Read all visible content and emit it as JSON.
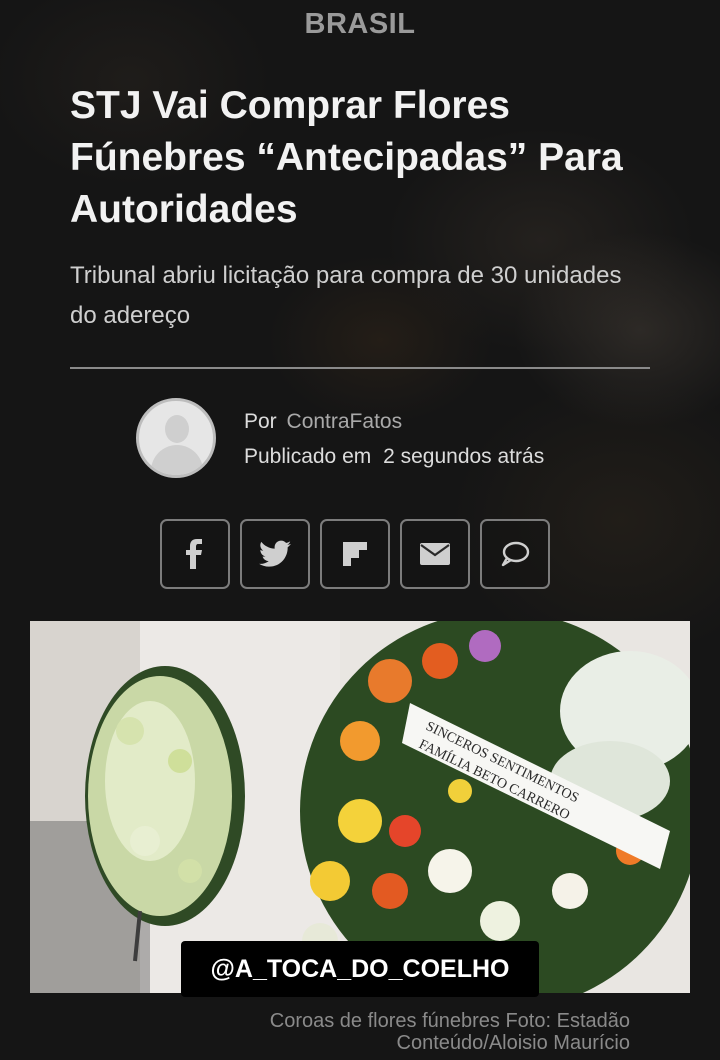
{
  "article": {
    "category": "BRASIL",
    "headline": "STJ Vai Comprar Flores Fúnebres “Antecipadas” Para Autoridades",
    "subtitle": "Tribunal abriu licitação para compra de 30 unidades do adereço"
  },
  "byline": {
    "by_label": "Por",
    "author": "ContraFatos",
    "published_label": "Publicado em",
    "published_time": "2 segundos atrás"
  },
  "share": [
    {
      "icon": "facebook-icon"
    },
    {
      "icon": "twitter-icon"
    },
    {
      "icon": "flipboard-icon"
    },
    {
      "icon": "email-icon"
    },
    {
      "icon": "comment-icon"
    }
  ],
  "photo": {
    "ribbon_text_line1": "SINCEROS SENTIMENTOS",
    "ribbon_text_line2": "FAMÍLIA BETO CARRERO",
    "caption": "Coroas de flores fúnebres Foto: Estadão Conteúdo/Aloisio Maurício"
  },
  "watermark": "@A_TOCA_DO_COELHO",
  "colors": {
    "background": "#151515",
    "headline": "#f2f2f2",
    "muted": "#9a9a9a"
  }
}
